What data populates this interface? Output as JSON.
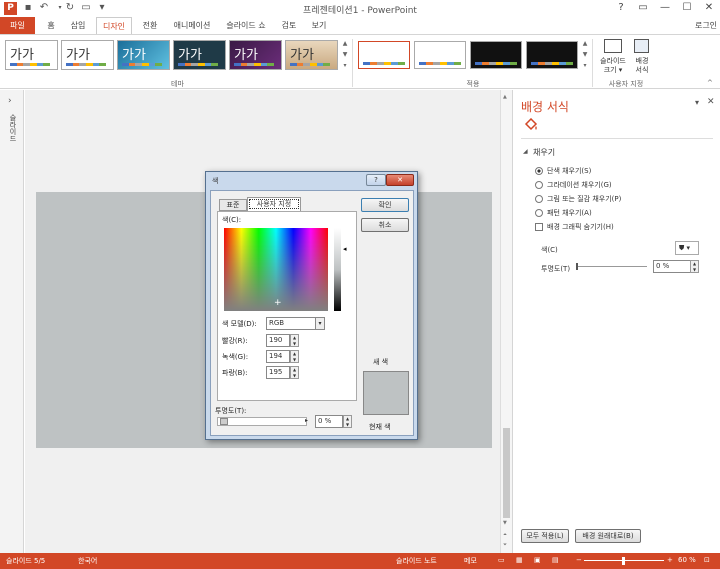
{
  "window": {
    "title": "프레젠테이션1 - PowerPoint",
    "logo": "P",
    "qat": [
      "save-icon",
      "undo-icon",
      "redo-icon",
      "present-icon"
    ],
    "controls": [
      "?",
      "▭",
      "—",
      "☐",
      "✕"
    ]
  },
  "tabs": {
    "file": "파일",
    "home": "홈",
    "insert": "삽입",
    "design": "디자인",
    "transitions": "전환",
    "animations": "애니메이션",
    "slideshow": "슬라이드 쇼",
    "review": "검토",
    "view": "보기",
    "login": "로그인"
  },
  "ribbon": {
    "theme_sample": "가가",
    "group_themes": "테마",
    "group_variants": "적용",
    "group_customize": "사용자 지정",
    "slide_size": "슬라이드\n크기",
    "slide_size_l1": "슬라이드",
    "slide_size_l2": "크기 ▾",
    "bg_format_l1": "배경",
    "bg_format_l2": "서식"
  },
  "left_pane": {
    "expand": "›",
    "label": "슬라이드"
  },
  "panel": {
    "title": "배경 서식",
    "section": "채우기",
    "fill_options": [
      "단색 채우기(S)",
      "그라데이션 채우기(G)",
      "그림 또는 질감 채우기(P)",
      "패턴 채우기(A)"
    ],
    "hide_bg": "배경 그래픽 숨기기(H)",
    "color_label": "색(C)",
    "transparency_label": "투명도(T)",
    "transparency_value": "0 %",
    "apply_all": "모두 적용(L)",
    "reset_bg": "배경 원래대로(B)"
  },
  "dialog": {
    "title": "색",
    "tab_standard": "표준",
    "tab_custom": "사용자 지정",
    "ok": "확인",
    "cancel": "취소",
    "colors_label": "색(C):",
    "color_model_label": "색 모델(D):",
    "color_model_value": "RGB",
    "red_label": "빨강(R):",
    "red_value": "190",
    "green_label": "녹색(G):",
    "green_value": "194",
    "blue_label": "파랑(B):",
    "blue_value": "195",
    "transparency_label": "투명도(T):",
    "transparency_value": "0 %",
    "new_label": "새 색",
    "current_label": "현재 색",
    "new_color": "#bec2c3",
    "current_color": "#bec2c3"
  },
  "status": {
    "slide": "슬라이드 5/5",
    "lang": "한국어",
    "notes": "슬라이드 노트",
    "comments": "메모",
    "zoom": "60 %"
  },
  "colors": {
    "accent": "#d24726",
    "slide_bg": "#bec2c3"
  }
}
